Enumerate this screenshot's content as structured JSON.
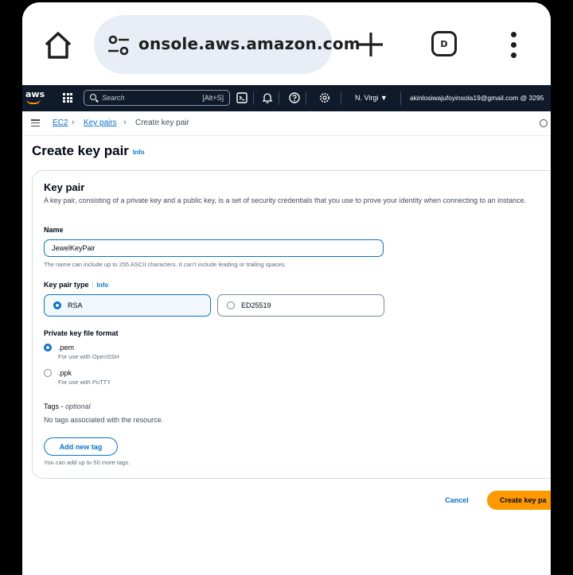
{
  "browser": {
    "url": "onsole.aws.amazon.com",
    "ext_label": "D"
  },
  "aws_nav": {
    "logo": "aws",
    "search_placeholder": "Search",
    "search_shortcut": "[Alt+S]",
    "region": "N. Virgi ▼",
    "account": "akinlosiwajufoyinsola19@gmail.com @ 3295"
  },
  "breadcrumb": {
    "items": [
      "EC2",
      "Key pairs",
      "Create key pair"
    ]
  },
  "page": {
    "title": "Create key pair",
    "info": "Info"
  },
  "key_pair": {
    "heading": "Key pair",
    "description": "A key pair, consisting of a private key and a public key, is a set of security credentials that you use to prove your identity when connecting to an instance.",
    "name_label": "Name",
    "name_value": "JewelKeyPair",
    "name_hint": "The name can include up to 255 ASCII characters. It can't include leading or trailing spaces.",
    "type_label": "Key pair type",
    "type_info": "Info",
    "type_options": [
      "RSA",
      "ED25519"
    ],
    "format_label": "Private key file format",
    "formats": [
      {
        "label": ".pem",
        "sub": "For use with OpenSSH"
      },
      {
        "label": ".ppk",
        "sub": "For use with PuTTY"
      }
    ],
    "tags_label": "Tags - ",
    "tags_optional": "optional",
    "tags_empty": "No tags associated with the resource.",
    "add_tag": "Add new tag",
    "tag_hint": "You can add up to 50 more tags."
  },
  "actions": {
    "cancel": "Cancel",
    "create": "Create key pa"
  },
  "colors": {
    "accent": "#0972d3",
    "primary_button": "#ff9900",
    "nav_bg": "#0f1b2a"
  }
}
